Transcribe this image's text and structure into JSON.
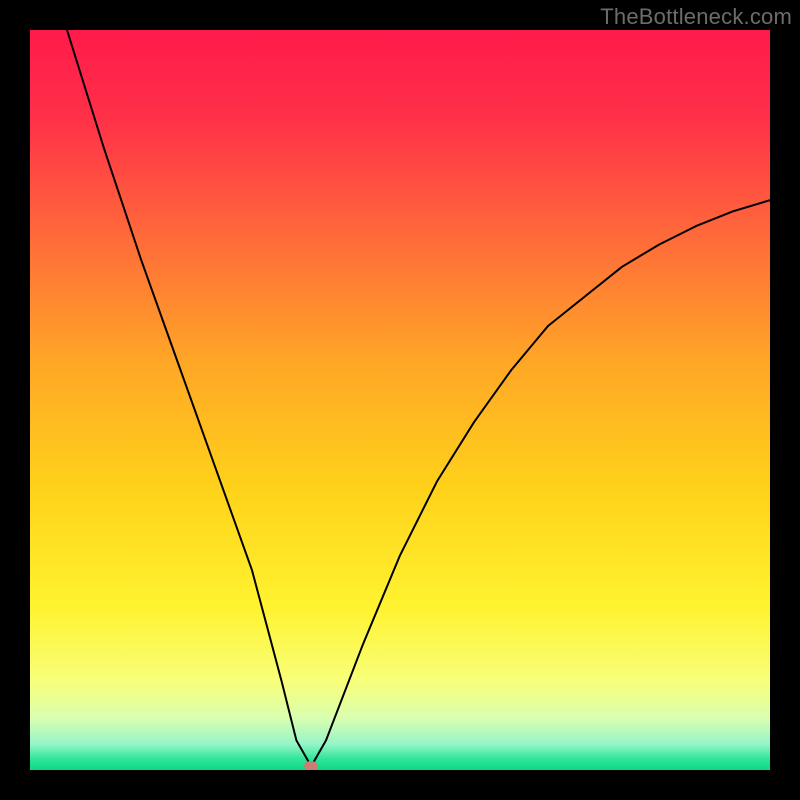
{
  "watermark": "TheBottleneck.com",
  "chart_data": {
    "type": "line",
    "title": "",
    "xlabel": "",
    "ylabel": "",
    "xlim": [
      0,
      100
    ],
    "ylim": [
      0,
      100
    ],
    "grid": false,
    "legend": false,
    "series": [
      {
        "name": "bottleneck-curve",
        "x": [
          5,
          10,
          15,
          20,
          25,
          30,
          34,
          36,
          38,
          40,
          45,
          50,
          55,
          60,
          65,
          70,
          75,
          80,
          85,
          90,
          95,
          100
        ],
        "values": [
          100,
          84,
          69,
          55,
          41,
          27,
          12,
          4,
          0.5,
          4,
          17,
          29,
          39,
          47,
          54,
          60,
          64,
          68,
          71,
          73.5,
          75.5,
          77
        ]
      }
    ],
    "optimum_point": {
      "x": 38,
      "y": 0.5
    },
    "background_gradient": {
      "stops": [
        {
          "offset": 0.0,
          "color": "#ff1a4b"
        },
        {
          "offset": 0.12,
          "color": "#ff3148"
        },
        {
          "offset": 0.28,
          "color": "#ff6a3a"
        },
        {
          "offset": 0.45,
          "color": "#ffa726"
        },
        {
          "offset": 0.62,
          "color": "#ffd21a"
        },
        {
          "offset": 0.78,
          "color": "#fff330"
        },
        {
          "offset": 0.88,
          "color": "#f8ff7a"
        },
        {
          "offset": 0.93,
          "color": "#d9ffb0"
        },
        {
          "offset": 0.965,
          "color": "#95f5c8"
        },
        {
          "offset": 0.985,
          "color": "#2fe59a"
        },
        {
          "offset": 1.0,
          "color": "#0fd786"
        }
      ]
    }
  }
}
